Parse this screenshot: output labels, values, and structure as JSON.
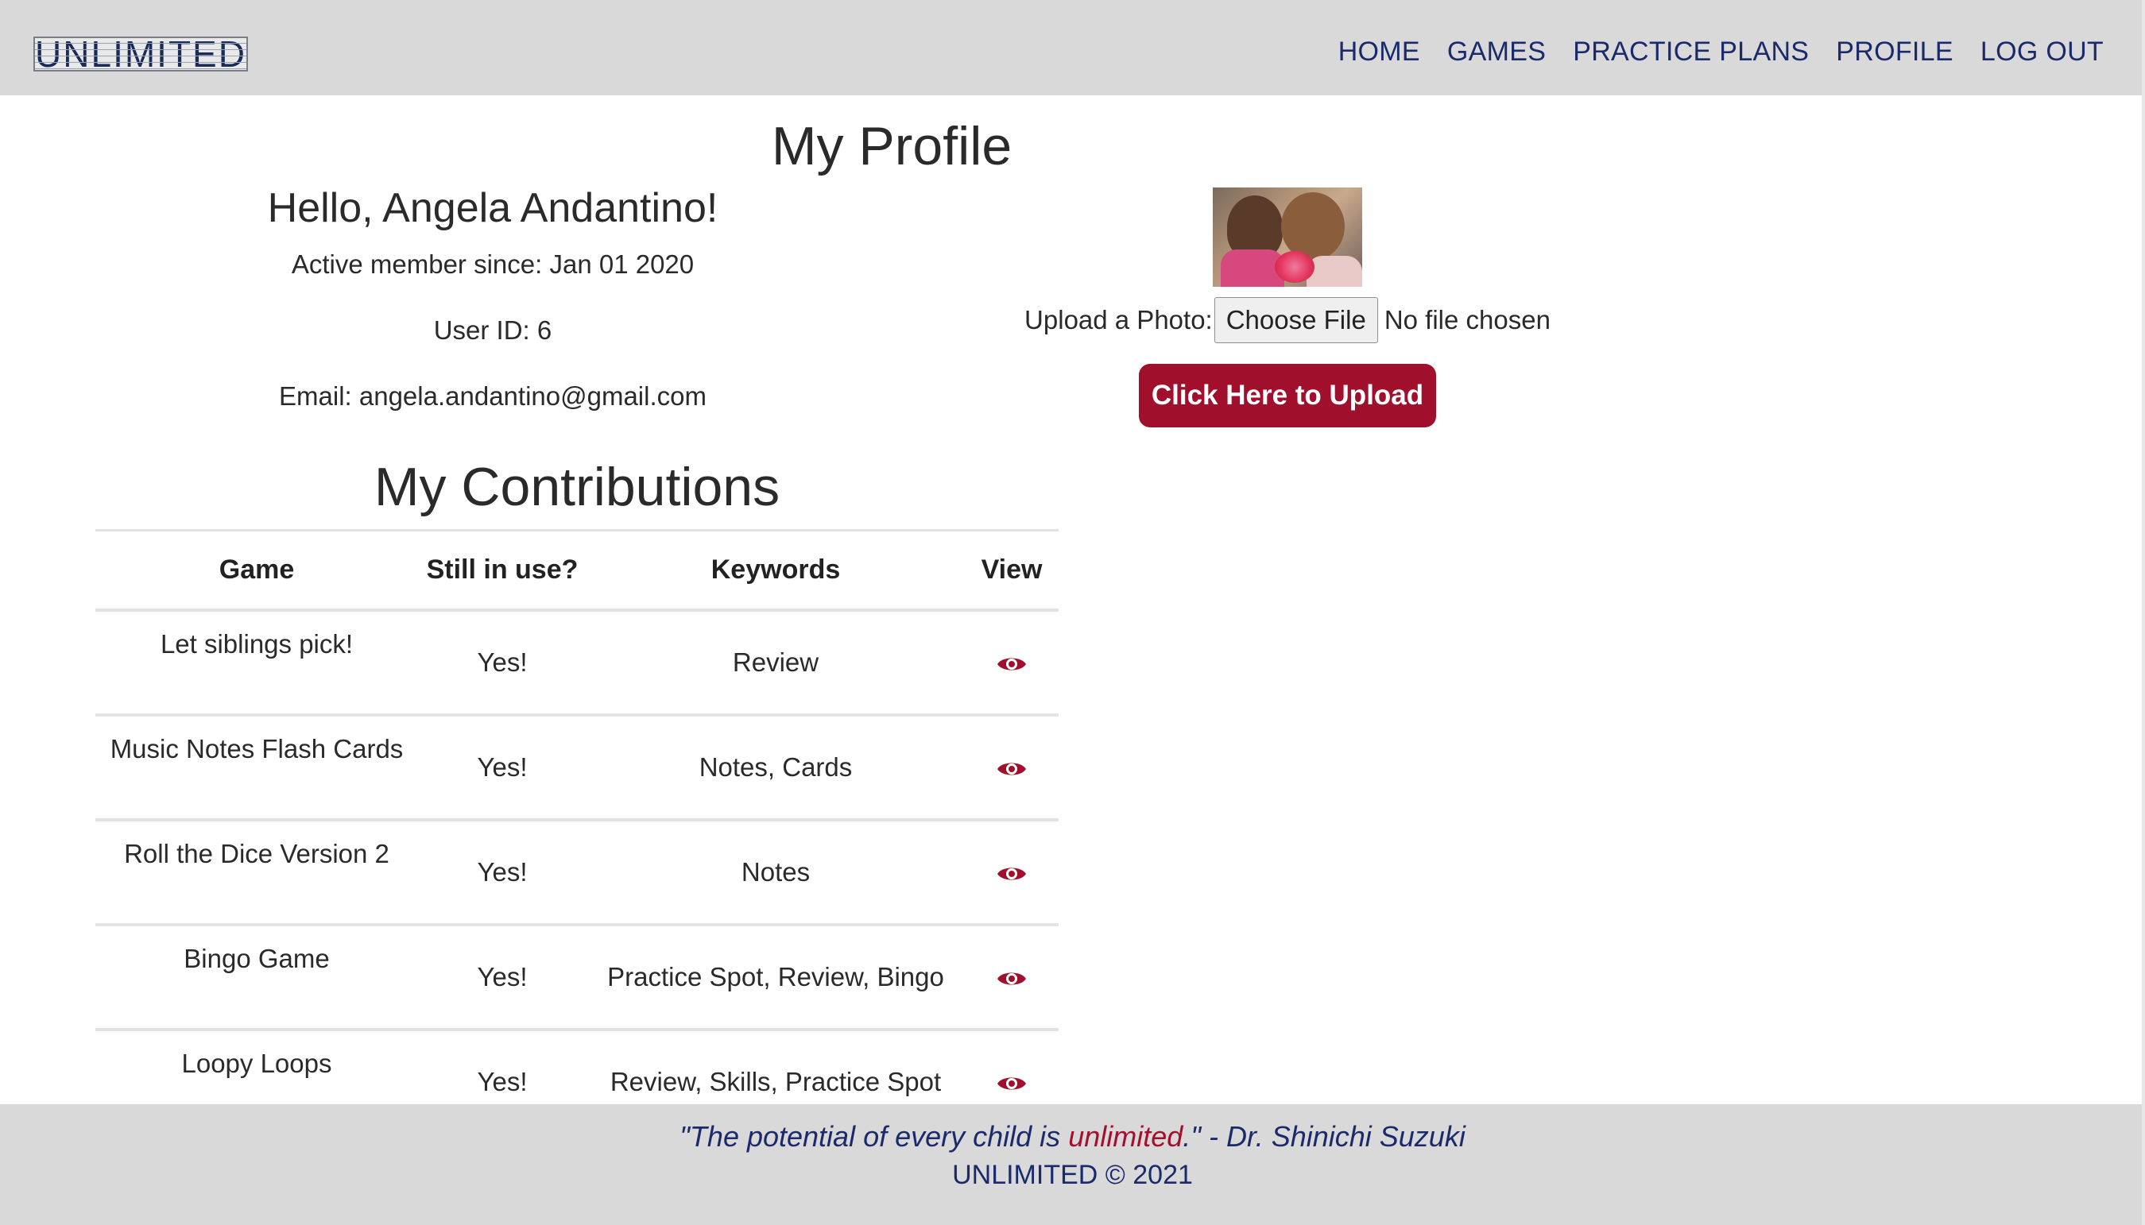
{
  "nav": {
    "logo_text": "UNLIMITED",
    "links": [
      "HOME",
      "GAMES",
      "PRACTICE PLANS",
      "PROFILE",
      "LOG OUT"
    ]
  },
  "profile": {
    "title": "My Profile",
    "greeting": "Hello, Angela Andantino!",
    "member_since": "Active member since: Jan 01 2020",
    "user_id": "User ID: 6",
    "email": "Email: angela.andantino@gmail.com",
    "upload_label": "Upload a Photo:",
    "choose_file": "Choose File",
    "no_file": "No file chosen",
    "upload_button": "Click Here to Upload"
  },
  "contributions": {
    "title": "My Contributions",
    "headers": [
      "Game",
      "Still in use?",
      "Keywords",
      "View"
    ],
    "rows": [
      {
        "game": "Let siblings pick!",
        "in_use": "Yes!",
        "keywords": "Review",
        "view_icon": "eye-icon"
      },
      {
        "game": "Music Notes Flash Cards",
        "in_use": "Yes!",
        "keywords": "Notes, Cards",
        "view_icon": "eye-icon"
      },
      {
        "game": "Roll the Dice Version 2",
        "in_use": "Yes!",
        "keywords": "Notes",
        "view_icon": "eye-icon"
      },
      {
        "game": "Bingo Game",
        "in_use": "Yes!",
        "keywords": "Practice Spot, Review, Bingo",
        "view_icon": "eye-icon"
      },
      {
        "game": "Loopy Loops",
        "in_use": "Yes!",
        "keywords": "Review, Skills, Practice Spot",
        "view_icon": "eye-icon"
      }
    ]
  },
  "footer": {
    "quote_open": "\"The potential of every child is ",
    "quote_accent": "unlimited",
    "quote_close": ".\" - Dr. Shinichi Suzuki",
    "copyright": "UNLIMITED © 2021"
  },
  "colors": {
    "brand_navy": "#1b2a6b",
    "accent_red": "#a0102c",
    "nav_bg": "#d9d9d9"
  }
}
